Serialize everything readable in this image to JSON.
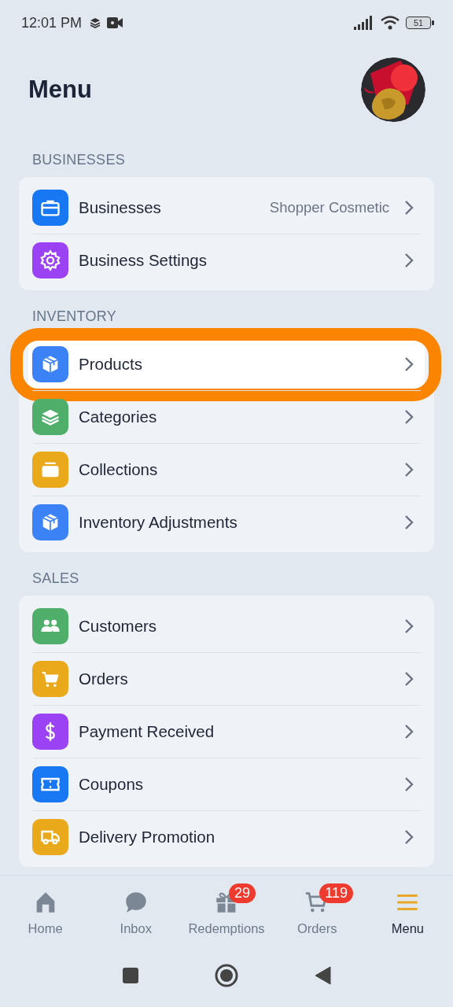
{
  "status_bar": {
    "time": "12:01 PM",
    "battery": "51"
  },
  "header": {
    "title": "Menu"
  },
  "sections": [
    {
      "label": "BUSINESSES",
      "items": [
        {
          "label": "Businesses",
          "value": "Shopper Cosmetic",
          "color": "#1877f2",
          "highlighted": false
        },
        {
          "label": "Business Settings",
          "color": "#9b42f5",
          "highlighted": false
        }
      ]
    },
    {
      "label": "INVENTORY",
      "items": [
        {
          "label": "Products",
          "color": "#3b82f6",
          "highlighted": true
        },
        {
          "label": "Categories",
          "color": "#4fae6a",
          "highlighted": false
        },
        {
          "label": "Collections",
          "color": "#eaa81b",
          "highlighted": false
        },
        {
          "label": "Inventory Adjustments",
          "color": "#3b82f6",
          "highlighted": false
        }
      ]
    },
    {
      "label": "SALES",
      "items": [
        {
          "label": "Customers",
          "color": "#4fae6a",
          "highlighted": false
        },
        {
          "label": "Orders",
          "color": "#eaa81b",
          "highlighted": false
        },
        {
          "label": "Payment Received",
          "color": "#9b42f5",
          "highlighted": false
        },
        {
          "label": "Coupons",
          "color": "#1877f2",
          "highlighted": false
        },
        {
          "label": "Delivery Promotion",
          "color": "#eaa81b",
          "highlighted": false
        }
      ]
    }
  ],
  "bottom_nav": [
    {
      "label": "Home",
      "selected": false
    },
    {
      "label": "Inbox",
      "selected": false
    },
    {
      "label": "Redemptions",
      "badge": "29",
      "selected": false
    },
    {
      "label": "Orders",
      "badge": "119",
      "selected": false
    },
    {
      "label": "Menu",
      "selected": true
    }
  ]
}
